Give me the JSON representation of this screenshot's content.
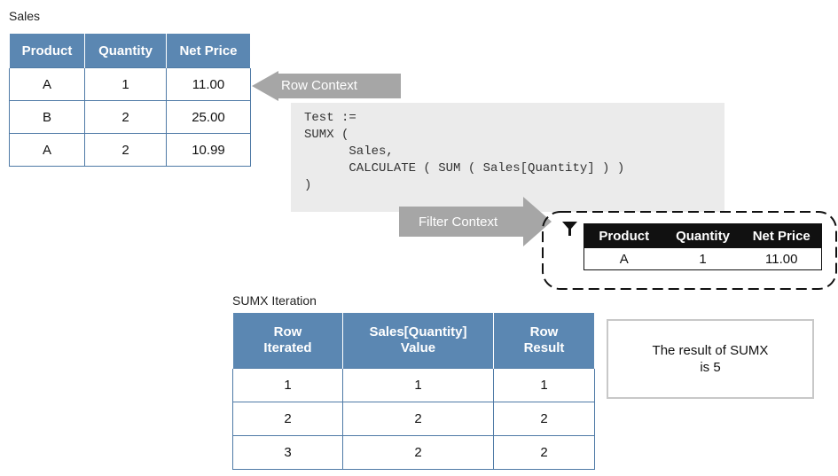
{
  "sales": {
    "caption": "Sales",
    "headers": [
      "Product",
      "Quantity",
      "Net Price"
    ],
    "rows": [
      [
        "A",
        "1",
        "11.00"
      ],
      [
        "B",
        "2",
        "25.00"
      ],
      [
        "A",
        "2",
        "10.99"
      ]
    ]
  },
  "row_context_label": "Row Context",
  "filter_context_label": "Filter Context",
  "code": "Test :=\nSUMX (\n      Sales,\n      CALCULATE ( SUM ( Sales[Quantity] ) )\n)",
  "filter_table": {
    "headers": [
      "Product",
      "Quantity",
      "Net Price"
    ],
    "row": [
      "A",
      "1",
      "11.00"
    ]
  },
  "iteration": {
    "caption": "SUMX Iteration",
    "headers": [
      "Row Iterated",
      "Sales[Quantity] Value",
      "Row Result"
    ],
    "rows": [
      [
        "1",
        "1",
        "1"
      ],
      [
        "2",
        "2",
        "2"
      ],
      [
        "3",
        "2",
        "2"
      ]
    ]
  },
  "result_text": "The result of SUMX is 5",
  "colors": {
    "header_blue": "#5b87b2",
    "arrow_gray": "#a6a6a6",
    "code_bg": "#ebebeb"
  },
  "icons": [
    "filter-icon"
  ]
}
